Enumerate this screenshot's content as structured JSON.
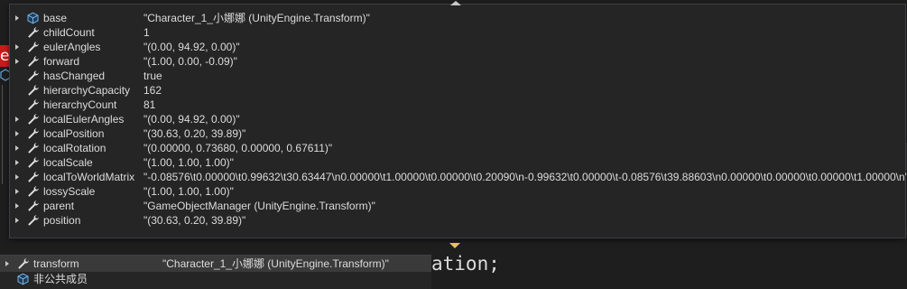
{
  "background": {
    "red_tag_text": "e",
    "code_text": "ation;"
  },
  "datatip": {
    "rows": [
      {
        "name": "base",
        "value": "\"Character_1_小娜娜 (UnityEngine.Transform)\"",
        "icon": "object-cube-icon",
        "expandable": true
      },
      {
        "name": "childCount",
        "value": "1",
        "icon": "wrench-icon",
        "expandable": false
      },
      {
        "name": "eulerAngles",
        "value": "\"(0.00, 94.92, 0.00)\"",
        "icon": "wrench-icon",
        "expandable": true
      },
      {
        "name": "forward",
        "value": "\"(1.00, 0.00, -0.09)\"",
        "icon": "wrench-icon",
        "expandable": true
      },
      {
        "name": "hasChanged",
        "value": "true",
        "icon": "wrench-icon",
        "expandable": false
      },
      {
        "name": "hierarchyCapacity",
        "value": "162",
        "icon": "wrench-icon",
        "expandable": false
      },
      {
        "name": "hierarchyCount",
        "value": "81",
        "icon": "wrench-icon",
        "expandable": false
      },
      {
        "name": "localEulerAngles",
        "value": "\"(0.00, 94.92, 0.00)\"",
        "icon": "wrench-icon",
        "expandable": true
      },
      {
        "name": "localPosition",
        "value": "\"(30.63, 0.20, 39.89)\"",
        "icon": "wrench-icon",
        "expandable": true
      },
      {
        "name": "localRotation",
        "value": "\"(0.00000, 0.73680, 0.00000, 0.67611)\"",
        "icon": "wrench-icon",
        "expandable": true
      },
      {
        "name": "localScale",
        "value": "\"(1.00, 1.00, 1.00)\"",
        "icon": "wrench-icon",
        "expandable": true
      },
      {
        "name": "localToWorldMatrix",
        "value": "\"-0.08576\\t0.00000\\t0.99632\\t30.63447\\n0.00000\\t1.00000\\t0.00000\\t0.20090\\n-0.99632\\t0.00000\\t-0.08576\\t39.88603\\n0.00000\\t0.00000\\t0.00000\\t1.00000\\n\"",
        "icon": "wrench-icon",
        "expandable": true
      },
      {
        "name": "lossyScale",
        "value": "\"(1.00, 1.00, 1.00)\"",
        "icon": "wrench-icon",
        "expandable": true
      },
      {
        "name": "parent",
        "value": "\"GameObjectManager (UnityEngine.Transform)\"",
        "icon": "wrench-icon",
        "expandable": true
      },
      {
        "name": "position",
        "value": "\"(30.63, 0.20, 39.89)\"",
        "icon": "wrench-icon",
        "expandable": true
      }
    ]
  },
  "locals": {
    "rows": [
      {
        "name": "transform",
        "value": "\"Character_1_小娜娜 (UnityEngine.Transform)\"",
        "icon": "wrench-icon",
        "expandable": true
      },
      {
        "name": "非公共成员",
        "value": "",
        "icon": "object-cube-icon",
        "expandable": false
      }
    ]
  }
}
